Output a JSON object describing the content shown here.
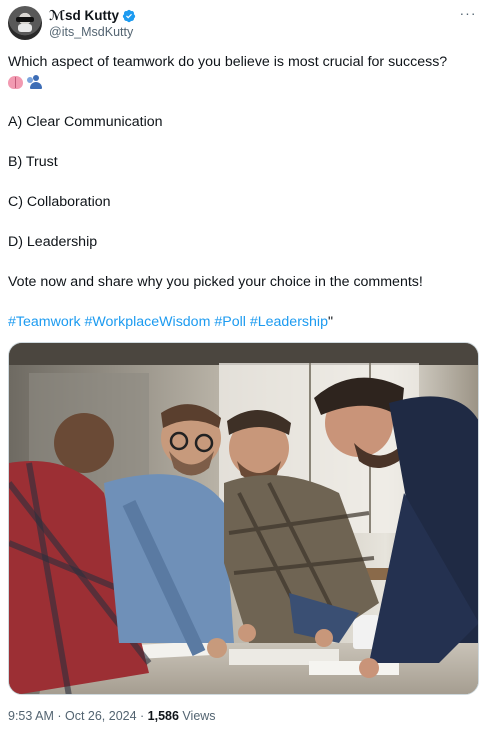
{
  "author": {
    "display_name": "ℳsd Kutty",
    "handle": "@its_MsdKutty",
    "verified": true
  },
  "post": {
    "question": "Which aspect of teamwork do you believe is most crucial for success?",
    "emojis": [
      "brain-emoji",
      "people-emoji"
    ],
    "options": [
      "A) Clear Communication",
      "B) Trust",
      "C) Collaboration",
      "D) Leadership"
    ],
    "call_to_action": "Vote now and share why you picked your choice in the comments!",
    "hashtags": [
      "#Teamwork",
      "#WorkplaceWisdom",
      "#Poll",
      "#Leadership"
    ],
    "trailing_quote": "\""
  },
  "meta": {
    "time": "9:53 AM",
    "separator": " · ",
    "date": "Oct 26, 2024",
    "views_count": "1,586",
    "views_label": " Views"
  },
  "colors": {
    "link": "#1d9bf0",
    "text": "#0f1419",
    "secondary": "#536471",
    "verified": "#1d9bf0"
  },
  "icons": {
    "more": "more-horizontal-icon",
    "verified": "verified-badge-icon"
  }
}
